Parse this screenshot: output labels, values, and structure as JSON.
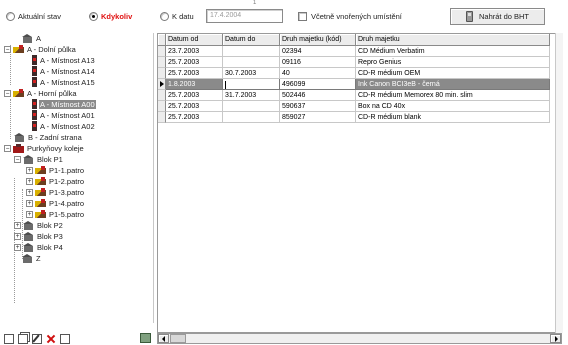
{
  "toolbar": {
    "radio_aktualni": "Aktuální stav",
    "radio_kdykoliv": "Kdykoliv",
    "radio_kdatu": "K datu",
    "date_value": "17.4.2004",
    "tick_mark": "1",
    "checkbox_label": "Včetně vnořených umístění",
    "bht_button": "Nahrát do BHT"
  },
  "tree": [
    {
      "label": "A"
    },
    {
      "label": "A - Dolní půlka"
    },
    {
      "label": "A - Místnost A13"
    },
    {
      "label": "A - Místnost A14"
    },
    {
      "label": "A - Místnost A15"
    },
    {
      "label": "A - Horní půlka"
    },
    {
      "label": "A - Místnost A00"
    },
    {
      "label": "A - Místnost A01"
    },
    {
      "label": "A - Místnost A02"
    },
    {
      "label": "B - Zadní strana"
    },
    {
      "label": "Purkyňovy koleje"
    },
    {
      "label": "Blok P1"
    },
    {
      "label": "P1-1.patro"
    },
    {
      "label": "P1-2.patro"
    },
    {
      "label": "P1-3.patro"
    },
    {
      "label": "P1-4.patro"
    },
    {
      "label": "P1-5.patro"
    },
    {
      "label": "Blok P2"
    },
    {
      "label": "Blok P3"
    },
    {
      "label": "Blok P4"
    },
    {
      "label": "Z"
    }
  ],
  "grid": {
    "headers": [
      "Datum od",
      "Datum do",
      "Druh majetku (kód)",
      "Druh majetku"
    ],
    "rows": [
      {
        "od": "23.7.2003",
        "do": "",
        "kod": "02394",
        "druh": "CD Médium Verbatim"
      },
      {
        "od": "25.7.2003",
        "do": "",
        "kod": "09116",
        "druh": "Repro Genius"
      },
      {
        "od": "25.7.2003",
        "do": "30.7.2003",
        "kod": "40",
        "druh": "CD-R médium OEM"
      },
      {
        "od": "1.8.2003",
        "do": "",
        "kod": "496099",
        "druh": "Ink Canon BCI3eB - černá"
      },
      {
        "od": "25.7.2003",
        "do": "31.7.2003",
        "kod": "502446",
        "druh": "CD-R médium Memorex 80 min. slim"
      },
      {
        "od": "25.7.2003",
        "do": "",
        "kod": "590637",
        "druh": "Box na CD 40x"
      },
      {
        "od": "25.7.2003",
        "do": "",
        "kod": "859027",
        "druh": "CD-R médium blank"
      }
    ]
  }
}
